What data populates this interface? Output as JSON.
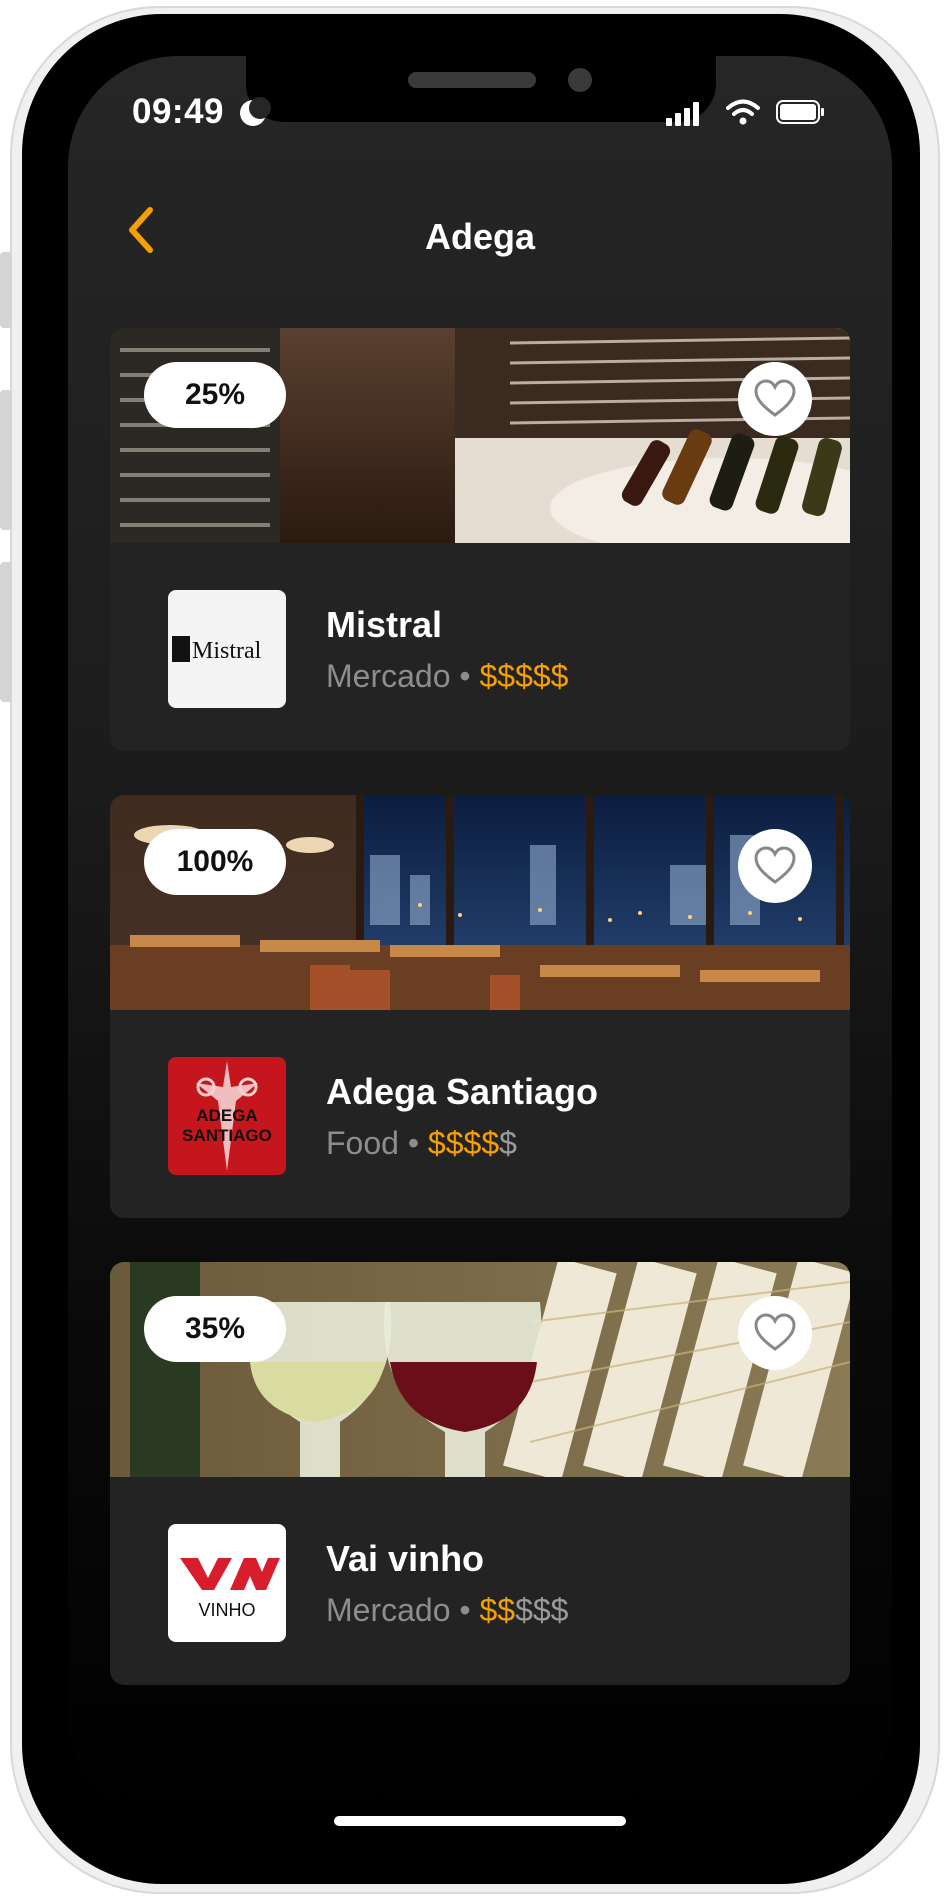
{
  "status_bar": {
    "time": "09:49"
  },
  "header": {
    "title": "Adega",
    "back_icon": "chevron-left-icon",
    "accent": "#f5a000"
  },
  "cards": [
    {
      "discount": "25%",
      "name": "Mistral",
      "category": "Mercado",
      "separator": "•",
      "price_active": "$$$$$",
      "price_inactive": "",
      "logo_text": "Mistral",
      "favorite_icon": "heart-outline-icon"
    },
    {
      "discount": "100%",
      "name": "Adega Santiago",
      "category": "Food",
      "separator": "•",
      "price_active": "$$$$",
      "price_inactive": "$",
      "logo_text_line1": "ADEGA",
      "logo_text_line2": "SANTIAGO",
      "favorite_icon": "heart-outline-icon"
    },
    {
      "discount": "35%",
      "name": "Vai vinho",
      "category": "Mercado",
      "separator": "•",
      "price_active": "$$",
      "price_inactive": "$$$",
      "logo_text": "VINHO",
      "favorite_icon": "heart-outline-icon"
    }
  ],
  "colors": {
    "background": "#1c1c1c",
    "card": "#232323",
    "price_active": "#f5a000",
    "price_inactive": "#9a9a9a"
  }
}
